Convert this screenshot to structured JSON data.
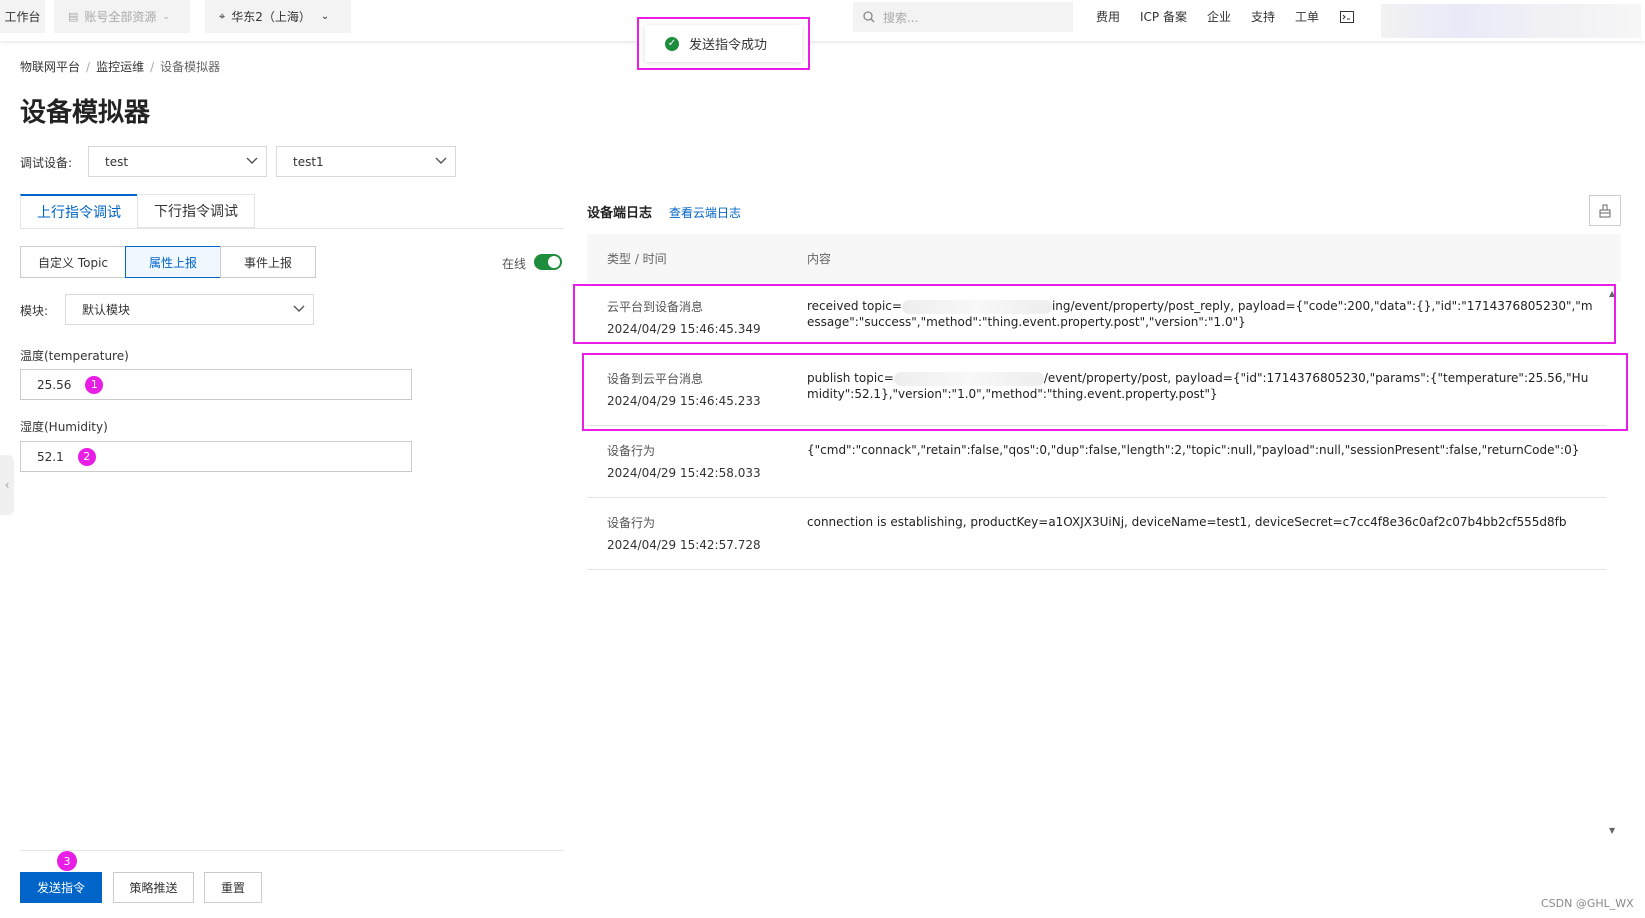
{
  "topbar": {
    "workbench": "工作台",
    "account_scope": "账号全部资源",
    "region": "华东2（上海）",
    "search_placeholder": "搜索...",
    "links": [
      "费用",
      "ICP 备案",
      "企业",
      "支持",
      "工单"
    ]
  },
  "toast": {
    "message": "发送指令成功"
  },
  "breadcrumb": [
    "物联网平台",
    "监控运维",
    "设备模拟器"
  ],
  "page_title": "设备模拟器",
  "debug_device": {
    "label": "调试设备:",
    "product": "test",
    "device": "test1"
  },
  "tabs": [
    "上行指令调试",
    "下行指令调试"
  ],
  "segments": [
    "自定义 Topic",
    "属性上报",
    "事件上报"
  ],
  "online_label": "在线",
  "module": {
    "label": "模块:",
    "value": "默认模块"
  },
  "fields": [
    {
      "label": "温度(temperature)",
      "value": "25.56",
      "badge": "1"
    },
    {
      "label": "湿度(Humidity)",
      "value": "52.1",
      "badge": "2"
    }
  ],
  "buttons": {
    "send": "发送指令",
    "strategy": "策略推送",
    "reset": "重置",
    "send_badge": "3"
  },
  "log": {
    "title": "设备端日志",
    "link": "查看云端日志",
    "col_type": "类型 / 时间",
    "col_content": "内容",
    "rows": [
      {
        "type": "云平台到设备消息",
        "time": "2024/04/29 15:46:45.349",
        "content_prefix": "received topic=",
        "content_rest": "ing/event/property/post_reply, payload={\"code\":200,\"data\":{},\"id\":\"1714376805230\",\"message\":\"success\",\"method\":\"thing.event.property.post\",\"version\":\"1.0\"}"
      },
      {
        "type": "设备到云平台消息",
        "time": "2024/04/29 15:46:45.233",
        "content_prefix": "publish topic=",
        "content_rest": "/event/property/post, payload={\"id\":1714376805230,\"params\":{\"temperature\":25.56,\"Humidity\":52.1},\"version\":\"1.0\",\"method\":\"thing.event.property.post\"}"
      },
      {
        "type": "设备行为",
        "time": "2024/04/29 15:42:58.033",
        "content_prefix": "",
        "content_rest": "{\"cmd\":\"connack\",\"retain\":false,\"qos\":0,\"dup\":false,\"length\":2,\"topic\":null,\"payload\":null,\"sessionPresent\":false,\"returnCode\":0}"
      },
      {
        "type": "设备行为",
        "time": "2024/04/29 15:42:57.728",
        "content_prefix": "",
        "content_rest": "connection is establishing, productKey=a1OXJX3UiNj, deviceName=test1, deviceSecret=c7cc4f8e36c0af2c07b4bb2cf555d8fb"
      }
    ]
  },
  "watermark": "CSDN @GHL_WX",
  "colors": {
    "primary": "#0064c8",
    "highlight": "#e81ee6",
    "success": "#1e8e3e"
  }
}
